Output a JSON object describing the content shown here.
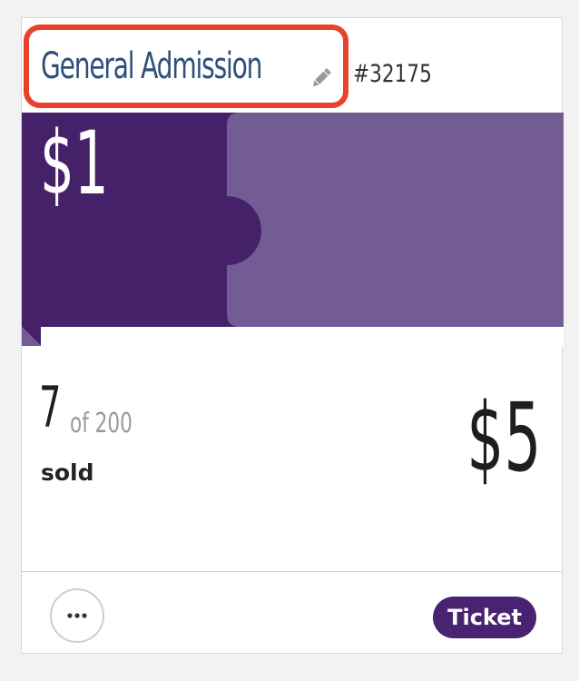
{
  "ticket": {
    "name": "General Admission",
    "id": "#32175",
    "banner_price": "$1",
    "sold_count": "7",
    "sold_total": "of 200",
    "sold_label": "sold",
    "price": "$5",
    "type": "Ticket"
  },
  "icons": {
    "edit": "pencil-icon",
    "more": "ellipsis-icon"
  },
  "colors": {
    "brand_dark_purple": "#45216a",
    "brand_light_purple": "#735b94",
    "title_blue": "#2e4f79",
    "highlight_red": "#e8412c"
  }
}
